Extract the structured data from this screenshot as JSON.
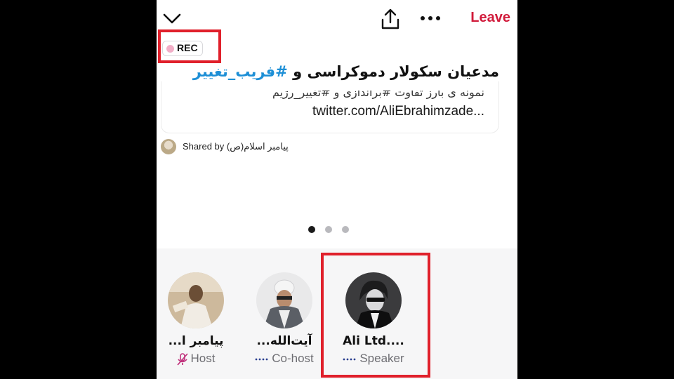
{
  "top_bar": {
    "leave_label": "Leave",
    "icons": [
      "chevron-down-icon",
      "share-icon",
      "more-icon"
    ]
  },
  "recording": {
    "label": "REC",
    "dot_color": "#f2aec7"
  },
  "space": {
    "title_prefix": "مدعیان سکولار دموکراسی و ",
    "title_hashtag": "#فریب_تغییر",
    "card_line": "نمونه ی بارز تفاوت #براندازی و #تغییر_رژیم",
    "card_url": "twitter.com/AliEbrahimzade...",
    "shared_by": "Shared by پیامبر اسلام(ص)"
  },
  "carousel": {
    "pages": 3,
    "active_index": 0
  },
  "speakers": [
    {
      "name": "پیامبر ا...",
      "role": "Host",
      "role_icon": "mic-off-icon"
    },
    {
      "name": "آیت‌الله...",
      "role": "Co-host",
      "role_icon": "audio-wave-icon"
    },
    {
      "name": "Ali Ltd....",
      "role": "Speaker",
      "role_icon": "audio-wave-icon"
    }
  ],
  "colors": {
    "accent": "#d11b3b",
    "hashtag": "#1d8fd6",
    "highlight_box": "#e0202b",
    "wave": "#2a3f8f"
  }
}
